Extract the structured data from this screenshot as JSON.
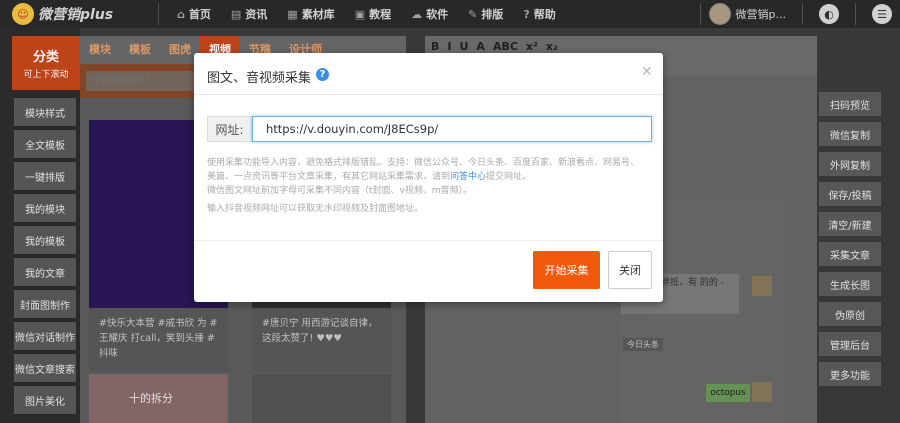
{
  "nav": {
    "logo_text": "微营销plus",
    "items": [
      {
        "icon": "home-icon",
        "glyph": "⌂",
        "label": "首页"
      },
      {
        "icon": "news-icon",
        "glyph": "▤",
        "label": "资讯"
      },
      {
        "icon": "library-icon",
        "glyph": "▦",
        "label": "素材库"
      },
      {
        "icon": "tutorial-icon",
        "glyph": "▣",
        "label": "教程"
      },
      {
        "icon": "cloud-icon",
        "glyph": "☁",
        "label": "软件"
      },
      {
        "icon": "edit-icon",
        "glyph": "✎",
        "label": "排版"
      },
      {
        "icon": "help-icon",
        "glyph": "?",
        "label": "帮助"
      }
    ],
    "username": "微营销p..."
  },
  "sidebar": {
    "head_title": "分类",
    "head_sub": "可上下滚动",
    "items": [
      "模块样式",
      "全文模板",
      "一键排版",
      "我的模块",
      "我的模板",
      "我的文章",
      "封面图制作",
      "微信对话制作",
      "微信文章搜索",
      "图片美化"
    ]
  },
  "material": {
    "tabs": [
      "模块",
      "模板",
      "图虎",
      "视频",
      "节稿",
      "设计师"
    ],
    "search_placeholder": "搜索视频素材",
    "cards": [
      {
        "caption": "#快乐大本营 #戚书欣 为 #王耀庆 打call，笑到头捶 #抖味"
      },
      {
        "caption": "#唐贝宁 用西游记谈自律，这段太赞了! ♥♥♥"
      },
      {
        "caption": "十的拆分"
      },
      {
        "caption": ""
      }
    ]
  },
  "editor": {
    "toolbar1": [
      "B",
      "I",
      "U",
      "A",
      "ABC",
      "x²",
      "x₂"
    ],
    "chat_text": "世界都靠胖抵，有 的的 - 今日头条",
    "chat_source": "今日头条",
    "green_msg": "octopus"
  },
  "right_buttons": [
    "扫码预览",
    "微信复制",
    "外网复制",
    "保存/投稿",
    "清空/新建",
    "采集文章",
    "生成长图",
    "伪原创",
    "管理后台",
    "更多功能"
  ],
  "modal": {
    "title": "图文、音视频采集",
    "url_label": "网址:",
    "url_value": "https://v.douyin.com/J8ECs9p/",
    "tip1": "使用采集功能导入内容，避免格式排版错乱。支持：微信公众号、今日头条、百度百家、新浪看点、网易号、美篇、一点资讯等平台文章采集，有其它网站采集需求，请到",
    "tip1_link": "问答中心",
    "tip1_end": "提交网址。",
    "tip2": "微信图文网址前加字母可采集不同内容（t封面、v视频、m音频）。",
    "tip3": "输入抖音视频网址可以获取无水印视频及封面图地址。",
    "start_label": "开始采集",
    "close_label": "关闭"
  }
}
